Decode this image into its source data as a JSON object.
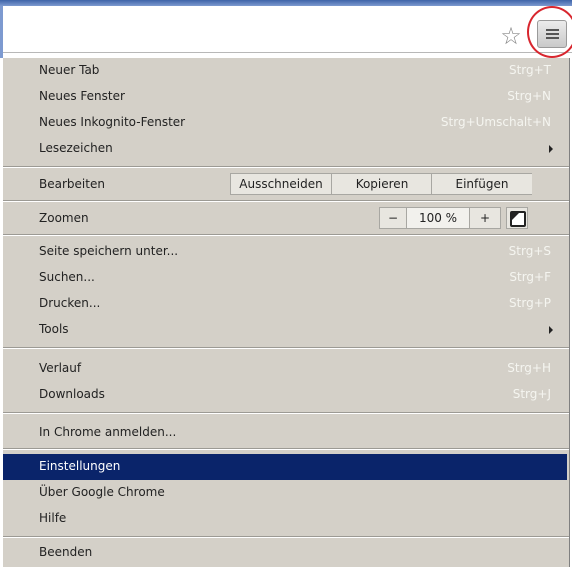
{
  "toolbar": {
    "bookmark_star": "☆",
    "menu_button_icon": "hamburger-menu"
  },
  "menu": {
    "group1": [
      {
        "label": "Neuer Tab",
        "shortcut": "Strg+T"
      },
      {
        "label": "Neues Fenster",
        "shortcut": "Strg+N"
      },
      {
        "label": "Neues Inkognito-Fenster",
        "shortcut": "Strg+Umschalt+N"
      },
      {
        "label": "Lesezeichen",
        "shortcut": ""
      }
    ],
    "edit": {
      "label": "Bearbeiten",
      "cut": "Ausschneiden",
      "copy": "Kopieren",
      "paste": "Einfügen"
    },
    "zoom": {
      "label": "Zoomen",
      "minus": "−",
      "level": "100 %",
      "plus": "+"
    },
    "group2": [
      {
        "label": "Seite speichern unter...",
        "shortcut": "Strg+S"
      },
      {
        "label": "Suchen...",
        "shortcut": "Strg+F"
      },
      {
        "label": "Drucken...",
        "shortcut": "Strg+P"
      },
      {
        "label": "Tools",
        "shortcut": ""
      }
    ],
    "group3": [
      {
        "label": "Verlauf",
        "shortcut": "Strg+H"
      },
      {
        "label": "Downloads",
        "shortcut": "Strg+J"
      }
    ],
    "signin": {
      "label": "In Chrome anmelden..."
    },
    "group4": [
      {
        "label": "Einstellungen"
      },
      {
        "label": "Über Google Chrome"
      },
      {
        "label": "Hilfe"
      }
    ],
    "exit": {
      "label": "Beenden"
    }
  },
  "colors": {
    "menu_bg": "#d4d0c8",
    "selected_bg": "#0a246a",
    "highlight_circle": "#d8262e"
  }
}
